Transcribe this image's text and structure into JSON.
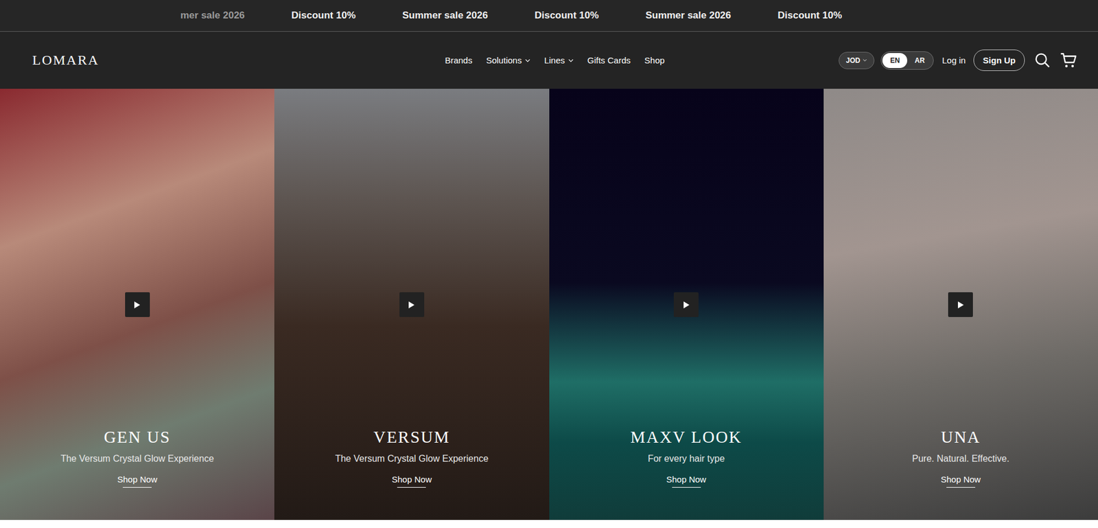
{
  "marquee": [
    "mer sale 2026",
    "Discount 10%",
    "Summer sale 2026",
    "Discount 10%",
    "Summer sale 2026",
    "Discount 10%"
  ],
  "nav": {
    "logo": "LOMARA",
    "links": [
      {
        "label": "Brands",
        "dropdown": false
      },
      {
        "label": "Solutions",
        "dropdown": true
      },
      {
        "label": "Lines",
        "dropdown": true
      },
      {
        "label": "Gifts Cards",
        "dropdown": false
      },
      {
        "label": "Shop",
        "dropdown": false
      }
    ],
    "currency": "JOD",
    "languages": [
      {
        "label": "EN",
        "selected": true
      },
      {
        "label": "AR",
        "selected": false
      }
    ],
    "login": "Log in",
    "signup": "Sign Up"
  },
  "hero": [
    {
      "title": "GEN US",
      "subtitle": "The Versum Crystal Glow Experience",
      "cta": "Shop Now"
    },
    {
      "title": "VERSUM",
      "subtitle": "The Versum Crystal Glow Experience",
      "cta": "Shop Now"
    },
    {
      "title": "MAXV LOOK",
      "subtitle": "For every hair type",
      "cta": "Shop Now"
    },
    {
      "title": "UNA",
      "subtitle": "Pure. Natural. Effective.",
      "cta": "Shop Now"
    }
  ]
}
